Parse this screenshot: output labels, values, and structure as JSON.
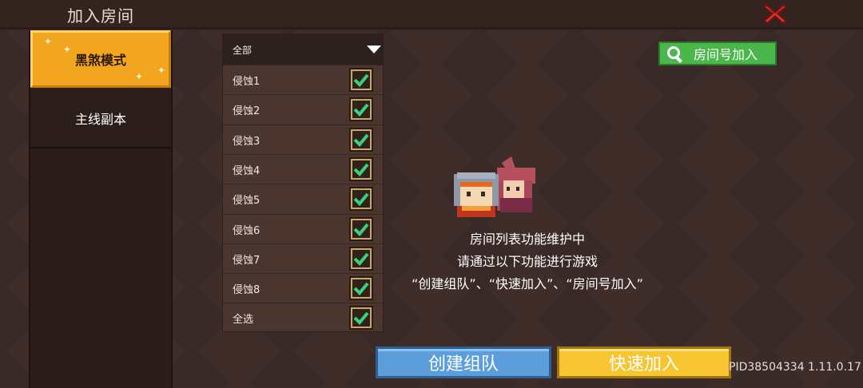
{
  "header": {
    "title": "加入房间",
    "close_icon": "close-x-icon"
  },
  "tabs": [
    {
      "label": "黑煞模式",
      "active": true
    },
    {
      "label": "主线副本",
      "active": false
    }
  ],
  "filter": {
    "header_label": "全部",
    "items": [
      {
        "label": "侵蚀1",
        "checked": true
      },
      {
        "label": "侵蚀2",
        "checked": true
      },
      {
        "label": "侵蚀3",
        "checked": true
      },
      {
        "label": "侵蚀4",
        "checked": true
      },
      {
        "label": "侵蚀5",
        "checked": true
      },
      {
        "label": "侵蚀6",
        "checked": true
      },
      {
        "label": "侵蚀7",
        "checked": true
      },
      {
        "label": "侵蚀8",
        "checked": true
      },
      {
        "label": "全选",
        "checked": true
      }
    ]
  },
  "room_id_join": {
    "label": "房间号加入",
    "icon": "search-icon"
  },
  "message": {
    "line1": "房间列表功能维护中",
    "line2": "请通过以下功能进行游戏",
    "line3": "“创建组队”、“快速加入”、“房间号加入”"
  },
  "buttons": {
    "create": "创建组队",
    "quick": "快速加入"
  },
  "footer": {
    "pid": "PID38504334 1.11.0.17"
  },
  "colors": {
    "accent_orange": "#f2a51f",
    "green": "#4ab64b",
    "blue": "#5b9edb",
    "yellow": "#f7c531",
    "check": "#3fd07a"
  }
}
